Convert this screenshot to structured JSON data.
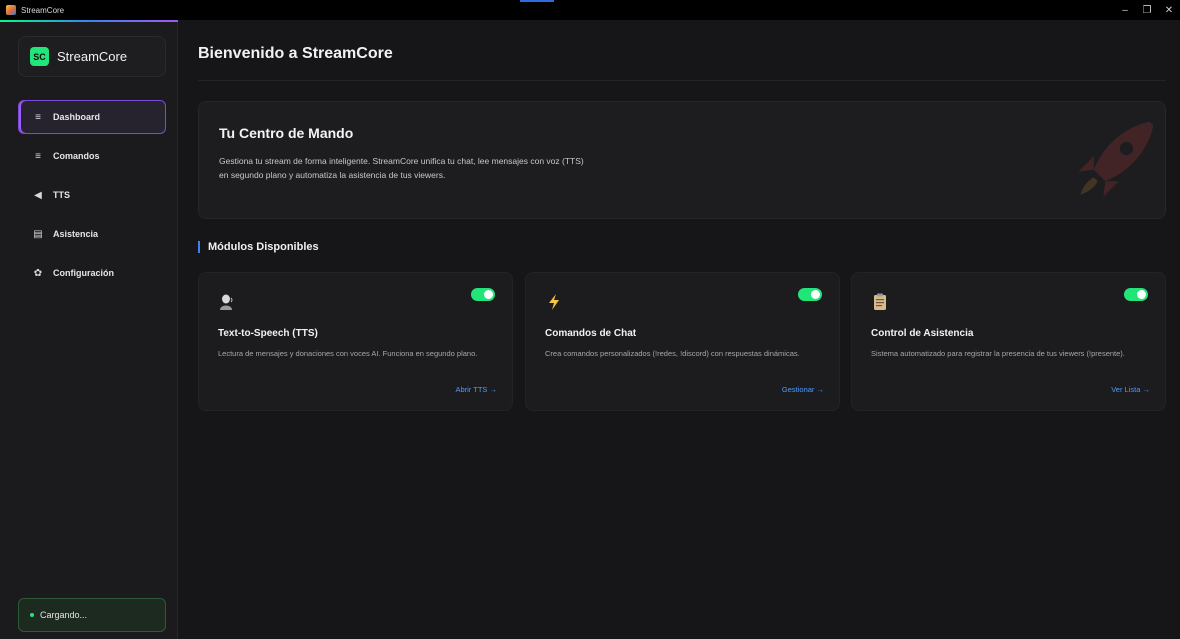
{
  "window": {
    "title": "StreamCore",
    "controls": {
      "minimize": "–",
      "maximize": "❐",
      "close": "✕"
    }
  },
  "sidebar": {
    "brand": {
      "logo": "SC",
      "name": "StreamCore"
    },
    "items": [
      {
        "label": "Dashboard",
        "icon": "≡",
        "icon_name": "menu-icon",
        "active": true
      },
      {
        "label": "Comandos",
        "icon": "≡",
        "icon_name": "list-icon",
        "active": false
      },
      {
        "label": "TTS",
        "icon": "◀",
        "icon_name": "speaker-icon",
        "active": false
      },
      {
        "label": "Asistencia",
        "icon": "▤",
        "icon_name": "clipboard-icon",
        "active": false
      },
      {
        "label": "Configuración",
        "icon": "✿",
        "icon_name": "gear-icon",
        "active": false
      }
    ],
    "status": "Cargando..."
  },
  "main": {
    "title": "Bienvenido a StreamCore",
    "hero": {
      "title": "Tu Centro de Mando",
      "description": "Gestiona tu stream de forma inteligente. StreamCore unifica tu chat, lee mensajes con voz (TTS) en segundo plano y automatiza la asistencia de tus viewers."
    },
    "section_title": "Módulos Disponibles",
    "cards": [
      {
        "icon": "🧑‍💼",
        "icon_name": "person-speaking-icon",
        "title": "Text-to-Speech (TTS)",
        "description": "Lectura de mensajes y donaciones con voces AI. Funciona en segundo plano.",
        "link": "Abrir TTS →",
        "enabled": true
      },
      {
        "icon": "⚡",
        "icon_name": "lightning-icon",
        "title": "Comandos de Chat",
        "description": "Crea comandos personalizados (!redes, !discord) con respuestas dinámicas.",
        "link": "Gestionar →",
        "enabled": true
      },
      {
        "icon": "📋",
        "icon_name": "clipboard-icon",
        "title": "Control de Asistencia",
        "description": "Sistema automatizado para registrar la presencia de tus viewers (!presente).",
        "link": "Ver Lista →",
        "enabled": true
      }
    ]
  },
  "colors": {
    "accent_green": "#22e57a",
    "accent_purple": "#7b4bd8",
    "link_blue": "#4c9bff"
  }
}
